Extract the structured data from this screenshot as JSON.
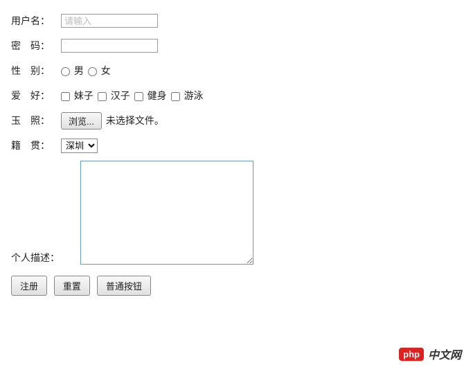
{
  "form": {
    "username": {
      "label": "用户名：",
      "placeholder": "请输入"
    },
    "password": {
      "label": "密　码："
    },
    "sex": {
      "label": "性　别：",
      "options": [
        "男",
        "女"
      ]
    },
    "hobby": {
      "label": "爱　好：",
      "options": [
        "妹子",
        "汉子",
        "健身",
        "游泳"
      ]
    },
    "photo": {
      "label": "玉　照：",
      "browse": "浏览...",
      "status": "未选择文件。"
    },
    "origin": {
      "label": "籍　贯：",
      "selected": "深圳"
    },
    "desc": {
      "label": "个人描述："
    }
  },
  "buttons": {
    "submit": "注册",
    "reset": "重置",
    "normal": "普通按钮"
  },
  "watermark": {
    "logo": "php",
    "text": "中文网"
  }
}
